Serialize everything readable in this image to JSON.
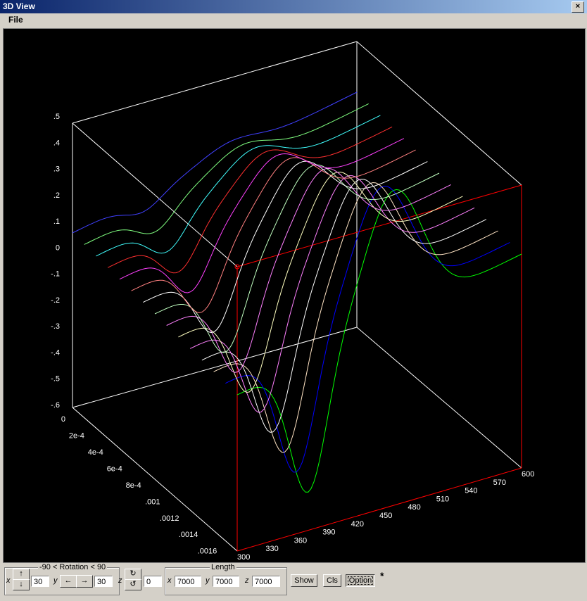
{
  "window": {
    "title": "3D View",
    "close_glyph": "×"
  },
  "menu": {
    "file": "File"
  },
  "plot": {
    "z_ticks": [
      ".5",
      ".4",
      ".3",
      ".2",
      ".1",
      "0",
      "-.1",
      "-.2",
      "-.3",
      "-.4",
      "-.5",
      "-.6"
    ],
    "y_ticks": [
      "0",
      "2e-4",
      "4e-4",
      "6e-4",
      "8e-4",
      ".001",
      ".0012",
      ".0014",
      ".0016"
    ],
    "x_ticks": [
      "300",
      "330",
      "360",
      "390",
      "420",
      "450",
      "480",
      "510",
      "540",
      "570",
      "600"
    ],
    "colors": {
      "box": "#ffffff",
      "front_box": "#ff0000",
      "curves": [
        "#00ff00",
        "#0000ff",
        "#ffe4c4",
        "#ffffff",
        "#ff80ff",
        "#ffffc0",
        "#ff80ff",
        "#c0ffc0",
        "#ffffff",
        "#ff8080",
        "#ff40ff",
        "#ff3030",
        "#40ffff",
        "#80ff80",
        "#4040ff"
      ]
    }
  },
  "controls": {
    "rotation_legend": "-90 < Rotation < 90",
    "length_legend": "Length",
    "x_label": "x",
    "y_label": "y",
    "z_label": "z",
    "up_arrow": "↑",
    "down_arrow": "↓",
    "left_arrow": "←",
    "right_arrow": "→",
    "rot_cw": "↻",
    "rot_ccw": "↺",
    "rot_x_value": "30",
    "rot_y_value": "30",
    "rot_z_value": "0",
    "len_x_label": "x",
    "len_y_label": "y",
    "len_z_label": "z",
    "len_x_value": "7000",
    "len_y_value": "7000",
    "len_z_value": "7000",
    "show_button": "Show",
    "cls_button": "Cls",
    "option_button": "Option",
    "asterisk": "*"
  }
}
